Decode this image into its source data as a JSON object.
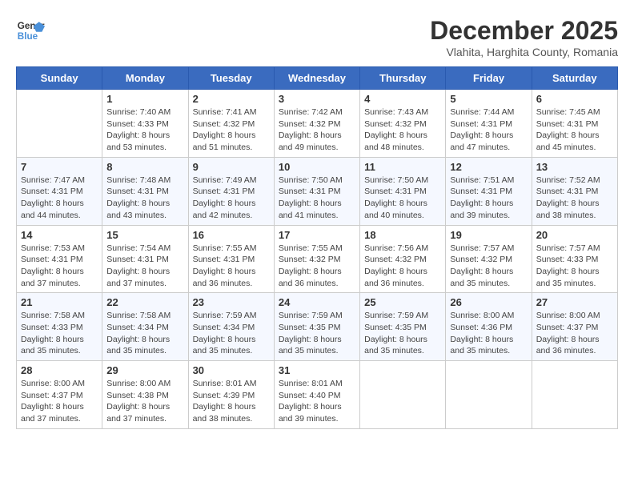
{
  "header": {
    "logo_line1": "General",
    "logo_line2": "Blue",
    "month": "December 2025",
    "location": "Vlahita, Harghita County, Romania"
  },
  "weekdays": [
    "Sunday",
    "Monday",
    "Tuesday",
    "Wednesday",
    "Thursday",
    "Friday",
    "Saturday"
  ],
  "weeks": [
    [
      {
        "day": "",
        "info": ""
      },
      {
        "day": "1",
        "info": "Sunrise: 7:40 AM\nSunset: 4:33 PM\nDaylight: 8 hours\nand 53 minutes."
      },
      {
        "day": "2",
        "info": "Sunrise: 7:41 AM\nSunset: 4:32 PM\nDaylight: 8 hours\nand 51 minutes."
      },
      {
        "day": "3",
        "info": "Sunrise: 7:42 AM\nSunset: 4:32 PM\nDaylight: 8 hours\nand 49 minutes."
      },
      {
        "day": "4",
        "info": "Sunrise: 7:43 AM\nSunset: 4:32 PM\nDaylight: 8 hours\nand 48 minutes."
      },
      {
        "day": "5",
        "info": "Sunrise: 7:44 AM\nSunset: 4:31 PM\nDaylight: 8 hours\nand 47 minutes."
      },
      {
        "day": "6",
        "info": "Sunrise: 7:45 AM\nSunset: 4:31 PM\nDaylight: 8 hours\nand 45 minutes."
      }
    ],
    [
      {
        "day": "7",
        "info": "Sunrise: 7:47 AM\nSunset: 4:31 PM\nDaylight: 8 hours\nand 44 minutes."
      },
      {
        "day": "8",
        "info": "Sunrise: 7:48 AM\nSunset: 4:31 PM\nDaylight: 8 hours\nand 43 minutes."
      },
      {
        "day": "9",
        "info": "Sunrise: 7:49 AM\nSunset: 4:31 PM\nDaylight: 8 hours\nand 42 minutes."
      },
      {
        "day": "10",
        "info": "Sunrise: 7:50 AM\nSunset: 4:31 PM\nDaylight: 8 hours\nand 41 minutes."
      },
      {
        "day": "11",
        "info": "Sunrise: 7:50 AM\nSunset: 4:31 PM\nDaylight: 8 hours\nand 40 minutes."
      },
      {
        "day": "12",
        "info": "Sunrise: 7:51 AM\nSunset: 4:31 PM\nDaylight: 8 hours\nand 39 minutes."
      },
      {
        "day": "13",
        "info": "Sunrise: 7:52 AM\nSunset: 4:31 PM\nDaylight: 8 hours\nand 38 minutes."
      }
    ],
    [
      {
        "day": "14",
        "info": "Sunrise: 7:53 AM\nSunset: 4:31 PM\nDaylight: 8 hours\nand 37 minutes."
      },
      {
        "day": "15",
        "info": "Sunrise: 7:54 AM\nSunset: 4:31 PM\nDaylight: 8 hours\nand 37 minutes."
      },
      {
        "day": "16",
        "info": "Sunrise: 7:55 AM\nSunset: 4:31 PM\nDaylight: 8 hours\nand 36 minutes."
      },
      {
        "day": "17",
        "info": "Sunrise: 7:55 AM\nSunset: 4:32 PM\nDaylight: 8 hours\nand 36 minutes."
      },
      {
        "day": "18",
        "info": "Sunrise: 7:56 AM\nSunset: 4:32 PM\nDaylight: 8 hours\nand 36 minutes."
      },
      {
        "day": "19",
        "info": "Sunrise: 7:57 AM\nSunset: 4:32 PM\nDaylight: 8 hours\nand 35 minutes."
      },
      {
        "day": "20",
        "info": "Sunrise: 7:57 AM\nSunset: 4:33 PM\nDaylight: 8 hours\nand 35 minutes."
      }
    ],
    [
      {
        "day": "21",
        "info": "Sunrise: 7:58 AM\nSunset: 4:33 PM\nDaylight: 8 hours\nand 35 minutes."
      },
      {
        "day": "22",
        "info": "Sunrise: 7:58 AM\nSunset: 4:34 PM\nDaylight: 8 hours\nand 35 minutes."
      },
      {
        "day": "23",
        "info": "Sunrise: 7:59 AM\nSunset: 4:34 PM\nDaylight: 8 hours\nand 35 minutes."
      },
      {
        "day": "24",
        "info": "Sunrise: 7:59 AM\nSunset: 4:35 PM\nDaylight: 8 hours\nand 35 minutes."
      },
      {
        "day": "25",
        "info": "Sunrise: 7:59 AM\nSunset: 4:35 PM\nDaylight: 8 hours\nand 35 minutes."
      },
      {
        "day": "26",
        "info": "Sunrise: 8:00 AM\nSunset: 4:36 PM\nDaylight: 8 hours\nand 35 minutes."
      },
      {
        "day": "27",
        "info": "Sunrise: 8:00 AM\nSunset: 4:37 PM\nDaylight: 8 hours\nand 36 minutes."
      }
    ],
    [
      {
        "day": "28",
        "info": "Sunrise: 8:00 AM\nSunset: 4:37 PM\nDaylight: 8 hours\nand 37 minutes."
      },
      {
        "day": "29",
        "info": "Sunrise: 8:00 AM\nSunset: 4:38 PM\nDaylight: 8 hours\nand 37 minutes."
      },
      {
        "day": "30",
        "info": "Sunrise: 8:01 AM\nSunset: 4:39 PM\nDaylight: 8 hours\nand 38 minutes."
      },
      {
        "day": "31",
        "info": "Sunrise: 8:01 AM\nSunset: 4:40 PM\nDaylight: 8 hours\nand 39 minutes."
      },
      {
        "day": "",
        "info": ""
      },
      {
        "day": "",
        "info": ""
      },
      {
        "day": "",
        "info": ""
      }
    ]
  ]
}
